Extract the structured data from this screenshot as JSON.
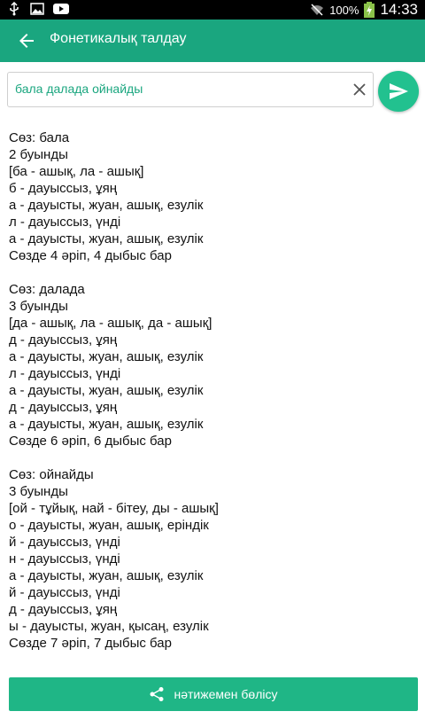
{
  "status_bar": {
    "icons_left": [
      "usb-icon",
      "image-icon",
      "youtube-icon"
    ],
    "battery_percent": "100%",
    "time": "14:33"
  },
  "app_bar": {
    "title": "Фонетикалық талдау"
  },
  "search": {
    "value": "бала далада ойнайды"
  },
  "results": [
    {
      "lines": [
        "Сөз:  бала",
        "2 буынды",
        "[ба - ашық, ла - ашық]",
        "б - дауыссыз, ұяң",
        "а - дауысты, жуан, ашық, езулік",
        "л - дауыссыз, үнді",
        "а - дауысты, жуан, ашық, езулік",
        "Сөзде 4 әріп, 4 дыбыс бар"
      ]
    },
    {
      "lines": [
        "Сөз:  далада",
        "3 буынды",
        "[да - ашық, ла - ашық, да - ашық]",
        "д - дауыссыз, ұяң",
        "а - дауысты, жуан, ашық, езулік",
        "л - дауыссыз, үнді",
        "а - дауысты, жуан, ашық, езулік",
        "д - дауыссыз, ұяң",
        "а - дауысты, жуан, ашық, езулік",
        "Сөзде 6 әріп, 6 дыбыс бар"
      ]
    },
    {
      "lines": [
        "Сөз:  ойнайды",
        "3 буынды",
        "[ой - тұйық, най - бітеу, ды - ашық]",
        "о - дауысты, жуан, ашық, еріндік",
        "й - дауыссыз, үнді",
        "н - дауыссыз, үнді",
        "а - дауысты, жуан, ашық, езулік",
        "й - дауыссыз, үнді",
        "д - дауыссыз, ұяң",
        "ы - дауысты, жуан, қысаң, езулік",
        "Сөзде 7 әріп, 7 дыбыс бар"
      ]
    }
  ],
  "share_button": {
    "label": "нәтижемен бөлісу"
  }
}
